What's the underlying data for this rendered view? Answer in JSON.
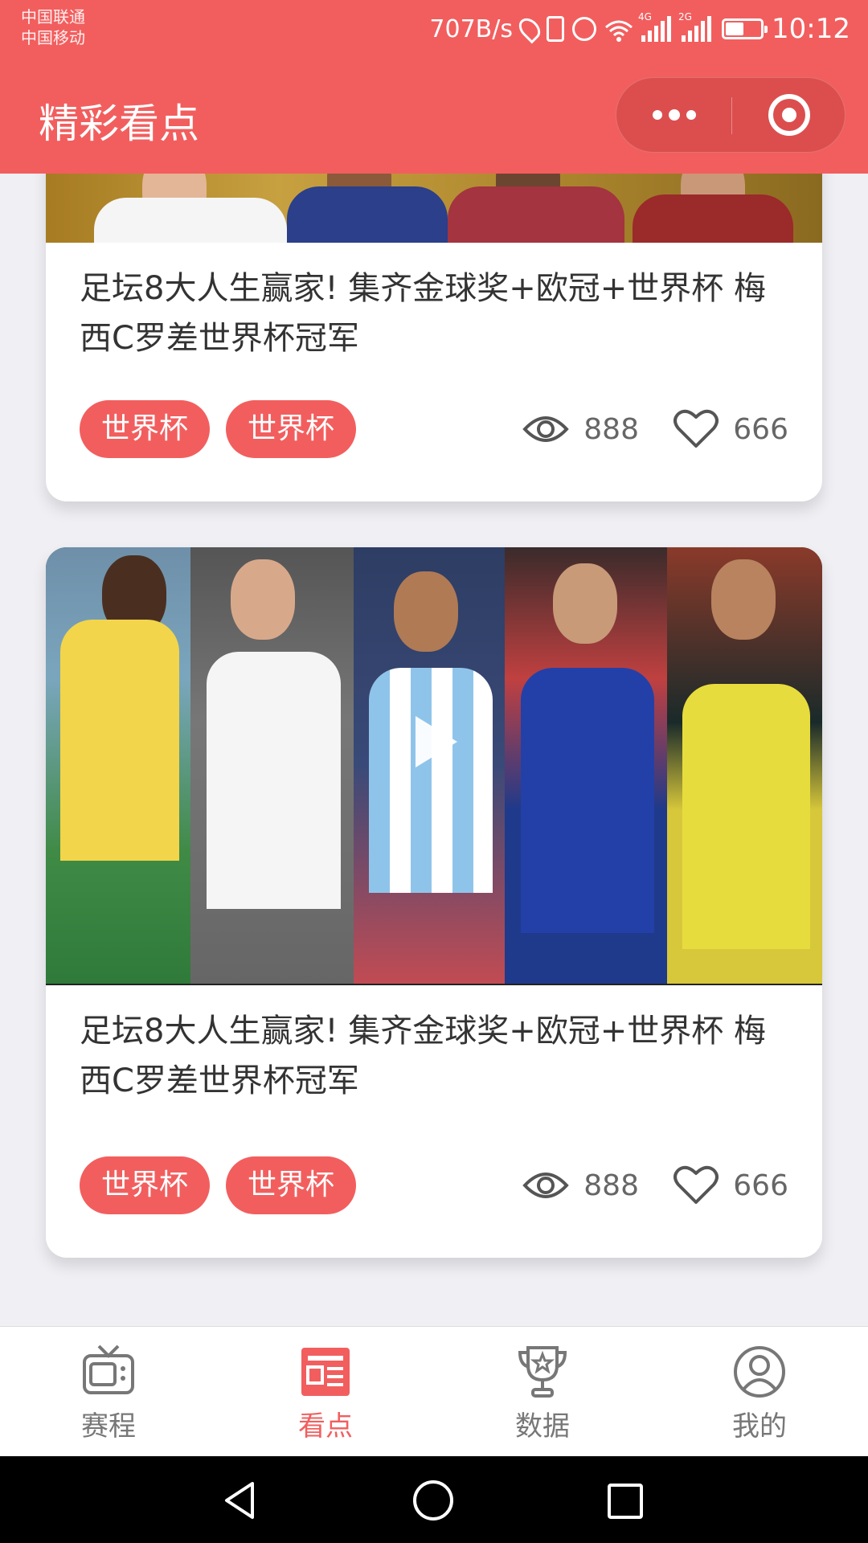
{
  "status_bar": {
    "carrier_1": "中国联通",
    "carrier_2": "中国移动",
    "net_speed": "707B/s",
    "signal_1_type": "4G",
    "signal_2_type": "2G",
    "time": "10:12",
    "battery_level": 0.45
  },
  "nav": {
    "title": "精彩看点",
    "menu_icon": "more-dots-icon",
    "close_icon": "mini-program-close-icon"
  },
  "cards": [
    {
      "title": "足坛8大人生赢家! 集齐金球奖+欧冠+世界杯 梅西C罗差世界杯冠军",
      "tags": [
        "世界杯",
        "世界杯"
      ],
      "views": "888",
      "likes": "666"
    },
    {
      "title": "足坛8大人生赢家! 集齐金球奖+欧冠+世界杯 梅西C罗差世界杯冠军",
      "tags": [
        "世界杯",
        "世界杯"
      ],
      "views": "888",
      "likes": "666",
      "has_video": true
    }
  ],
  "tabbar": {
    "items": [
      {
        "label": "赛程",
        "icon": "tv-icon",
        "active": false
      },
      {
        "label": "看点",
        "icon": "news-icon",
        "active": true
      },
      {
        "label": "数据",
        "icon": "trophy-icon",
        "active": false
      },
      {
        "label": "我的",
        "icon": "user-icon",
        "active": false
      }
    ]
  },
  "colors": {
    "brand": "#f25e5e",
    "background": "#efeff4",
    "text": "#333333",
    "muted": "#666666"
  }
}
